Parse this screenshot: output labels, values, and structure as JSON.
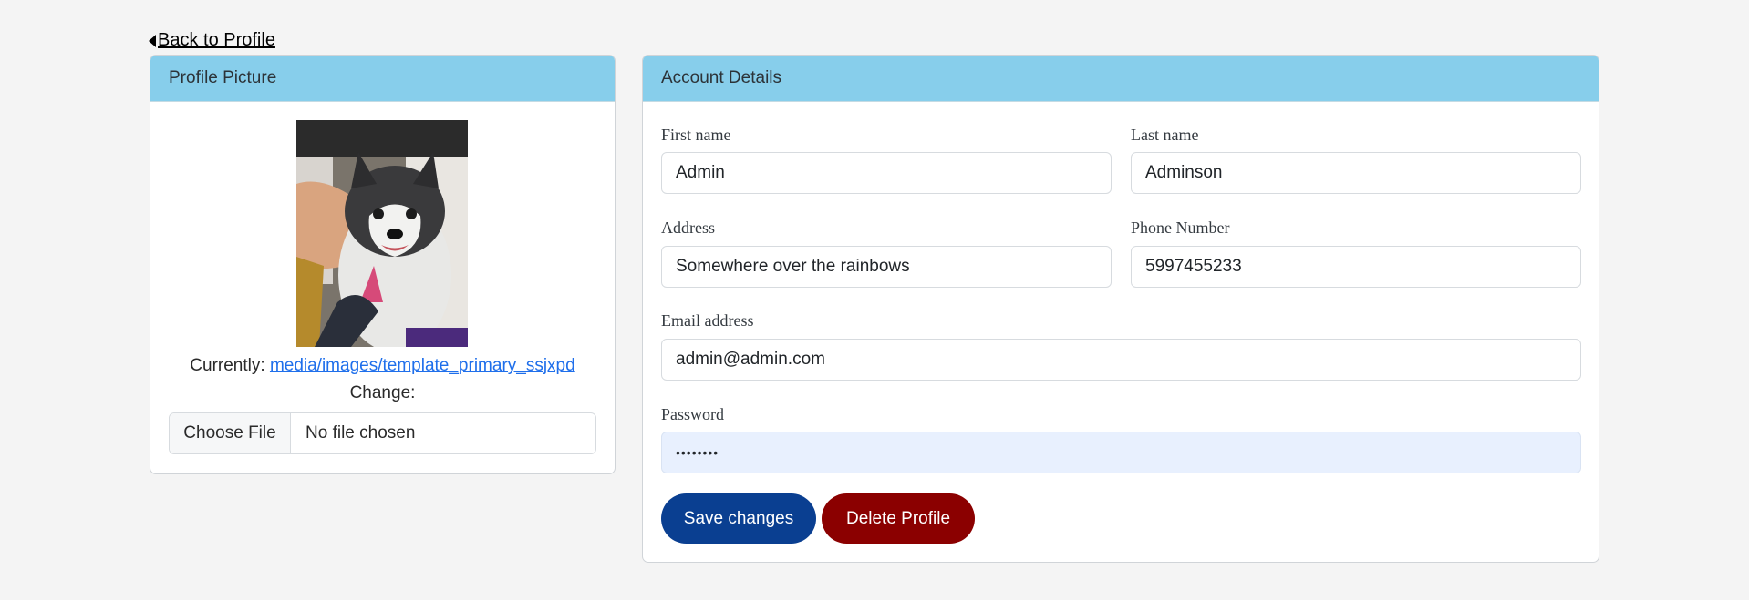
{
  "nav": {
    "back_label": "Back to Profile"
  },
  "profile_picture": {
    "header": "Profile Picture",
    "currently_label": "Currently:",
    "current_file": "media/images/template_primary_ssjxpd",
    "change_label": "Change:",
    "choose_file_label": "Choose File",
    "no_file_label": "No file chosen"
  },
  "account": {
    "header": "Account Details",
    "first_name": {
      "label": "First name",
      "value": "Admin"
    },
    "last_name": {
      "label": "Last name",
      "value": "Adminson"
    },
    "address": {
      "label": "Address",
      "value": "Somewhere over the rainbows"
    },
    "phone": {
      "label": "Phone Number",
      "value": "5997455233"
    },
    "email": {
      "label": "Email address",
      "value": "admin@admin.com"
    },
    "password": {
      "label": "Password",
      "value": "••••••••"
    },
    "save_label": "Save changes",
    "delete_label": "Delete Profile"
  },
  "colors": {
    "header_bg": "#87ceeb",
    "save_button": "#0a3f91",
    "delete_button": "#8b0000",
    "link": "#1f6feb",
    "autofill_bg": "#e8f0fe"
  }
}
